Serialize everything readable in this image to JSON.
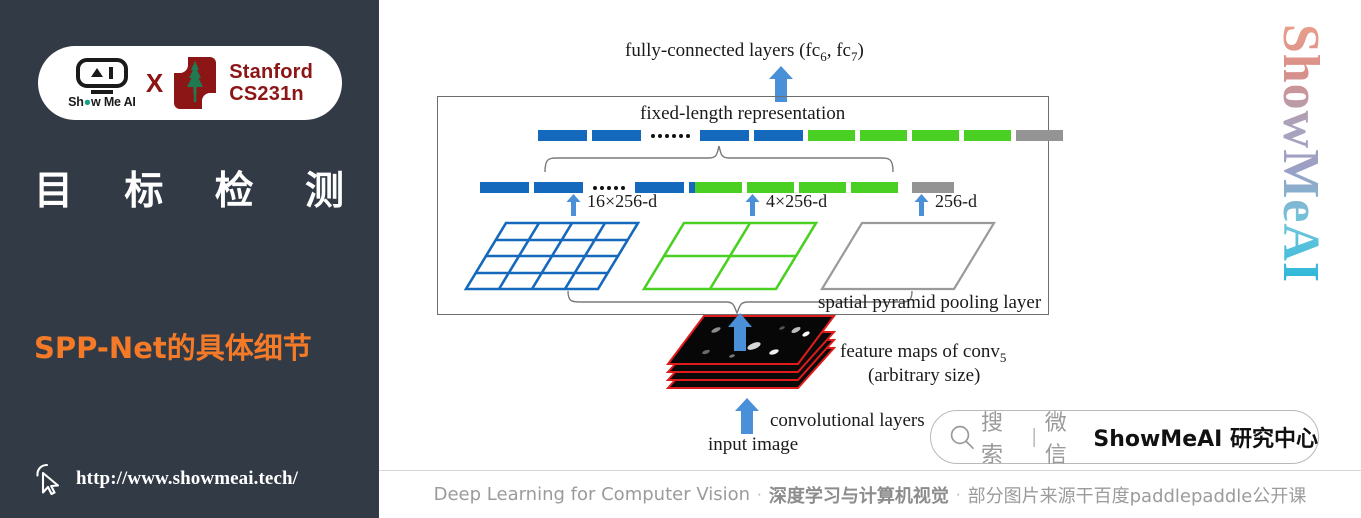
{
  "sidebar": {
    "badge": {
      "showmeai_label": "Show Me AI",
      "cross_label": "X",
      "stanford_line1": "Stanford",
      "stanford_line2": "CS231n"
    },
    "title_chars": [
      "目",
      "标",
      "检",
      "测"
    ],
    "subtitle": "SPP-Net的具体细节",
    "url": "http://www.showmeai.tech/",
    "cursor_icon": "cursor-arrow-icon",
    "background_color": "#313a45",
    "accent_color": "#f47a28"
  },
  "brand": {
    "vertical_wordmark": "ShowMeAI"
  },
  "figure": {
    "label_fc_prefix": "fully-connected layers (fc",
    "label_fc_sub1": "6",
    "label_fc_mid": ", fc",
    "label_fc_sub2": "7",
    "label_fc_suffix": ")",
    "label_fixed_length": "fixed-length representation",
    "dim_16": "16×256-d",
    "dim_4": "4×256-d",
    "dim_256": "256-d",
    "label_spp": "spatial pyramid pooling layer",
    "label_featmaps_prefix": "feature maps of conv",
    "label_featmaps_sub": "5",
    "label_featmaps_line2": "(arbitrary size)",
    "label_conv": "convolutional layers",
    "label_input": "input image",
    "colors": {
      "blue": "#1569bd",
      "green": "#4ad023",
      "gray": "#949494",
      "box_border": "#6d6d6d",
      "arrow_blue": "#4a90d9",
      "featmap_border": "#e01b1b"
    },
    "bars": {
      "top_row": [
        "blue",
        "blue",
        "dots",
        "blue",
        "blue",
        "green",
        "green",
        "green",
        "green",
        "gray"
      ],
      "blue_row": [
        "blue",
        "blue",
        "dots",
        "blue",
        "blue"
      ],
      "green_row": [
        "green",
        "green",
        "green",
        "green"
      ],
      "gray_row": [
        "gray"
      ]
    },
    "grids": [
      {
        "name": "blue-grid",
        "divisions": "4x4",
        "color": "#1569bd"
      },
      {
        "name": "green-grid",
        "divisions": "2x2",
        "color": "#4ad023"
      },
      {
        "name": "gray-grid",
        "divisions": "1x1",
        "color": "#949494"
      }
    ]
  },
  "search": {
    "icon": "magnifier-icon",
    "placeholder": "搜索",
    "divider": "|",
    "channel": "微信",
    "brand": "ShowMeAI 研究中心"
  },
  "footer": {
    "en_title": "Deep Learning for Computer Vision",
    "sep1": "·",
    "cn_title": "深度学习与计算机视觉",
    "sep2": "·",
    "source": "部分图片来源干百度paddlepaddle公开课"
  }
}
